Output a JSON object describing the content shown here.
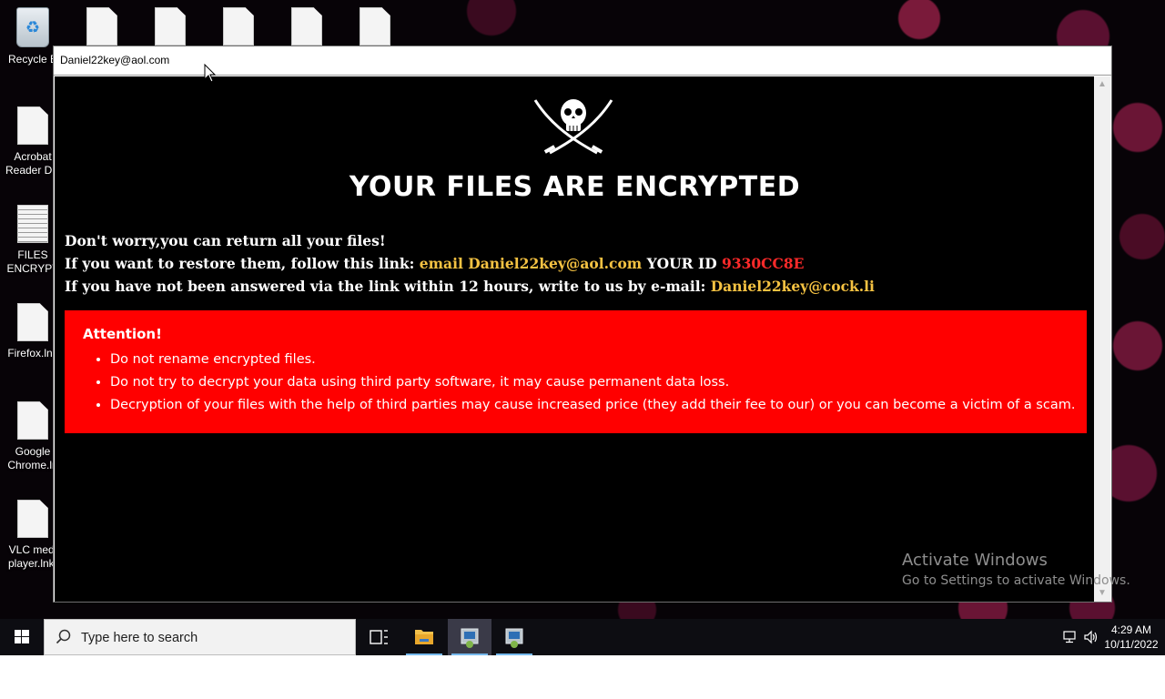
{
  "desktop": {
    "icons": [
      {
        "label": "Recycle B",
        "glyph": "recycle-bin-icon"
      },
      {
        "label": "Acrobat\nReader DC",
        "glyph": "file-icon"
      },
      {
        "label": "FILES\nENCRYPT",
        "glyph": "text-file-icon"
      },
      {
        "label": "Firefox.lnk",
        "glyph": "file-icon"
      },
      {
        "label": "Google\nChrome.ln",
        "glyph": "file-icon"
      },
      {
        "label": "VLC medi\nplayer.lnk.",
        "glyph": "file-icon"
      }
    ]
  },
  "window": {
    "title": "Daniel22key@aol.com"
  },
  "note": {
    "headline": "YOUR FILES ARE ENCRYPTED",
    "line1": "Don't worry,you can return all your files!",
    "line2_prefix": "If you want to restore them, follow this link: ",
    "line2_email": "email Daniel22key@aol.com",
    "line2_id_label": "  YOUR ID ",
    "line2_id": "9330CC8E",
    "line3_prefix": "If you have not been answered via the link within 12 hours, write to us by e-mail: ",
    "line3_email": "Daniel22key@cock.li",
    "attention": {
      "title": "Attention!",
      "items": [
        "Do not rename encrypted files.",
        "Do not try to decrypt your data using third party software, it may cause permanent data loss.",
        "Decryption of your files with the help of third parties may cause increased price (they add their fee to our) or you can become a victim of a scam."
      ]
    }
  },
  "watermark": {
    "title": "Activate Windows",
    "subtitle": "Go to Settings to activate Windows."
  },
  "taskbar": {
    "search_placeholder": "Type here to search",
    "time": "4:29 AM",
    "date": "10/11/2022"
  },
  "colors": {
    "accent_gold": "#f5c242",
    "id_red": "#ff2a2a",
    "attention_bg": "#ff0000"
  }
}
